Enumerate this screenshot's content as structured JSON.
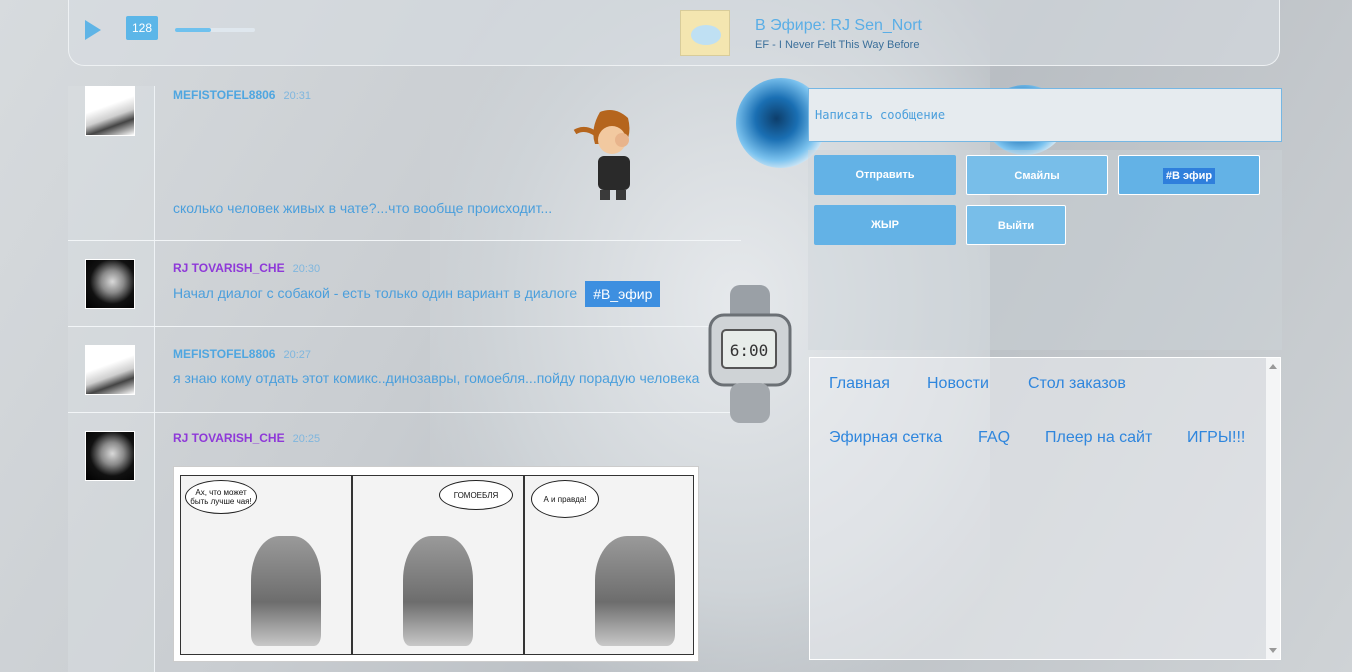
{
  "player": {
    "volume": "128",
    "progress": 0.45,
    "now_playing_title": "В Эфире: RJ Sen_Nort",
    "now_playing_track": "EF - I Never Felt This Way Before"
  },
  "chat": {
    "messages": [
      {
        "nick": "MEFISTOFEL8806",
        "time": "20:31",
        "text": "сколько человек живых в чате?...что вообще происходит...",
        "color": "blue",
        "avatar": "cat-avatar"
      },
      {
        "nick": "RJ TOVARISH_CHE",
        "time": "20:30",
        "text": "Начал диалог с собакой - есть только один вариант в диалоге",
        "tag": "#В_эфир",
        "color": "purple",
        "avatar": "man-avatar"
      },
      {
        "nick": "MEFISTOFEL8806",
        "time": "20:27",
        "text": "я знаю кому отдать этот комикс..динозавры, гомоебля...пойду порадую человека",
        "color": "blue",
        "avatar": "cat-avatar"
      },
      {
        "nick": "RJ TOVARISH_CHE",
        "time": "20:25",
        "color": "purple",
        "avatar": "man-avatar"
      }
    ],
    "comic": {
      "bubble1": "Ах, что может быть лучше чая!",
      "bubble2": "ГОМОЕБЛЯ",
      "bubble3": "А и правда!"
    }
  },
  "compose": {
    "placeholder": "Написать сообщение"
  },
  "buttons": {
    "send": "Отправить",
    "smiles": "Смайлы",
    "on_air": "#В эфир",
    "zhyr": "ЖЫР",
    "logout": "Выйти"
  },
  "nav": {
    "links": [
      "Главная",
      "Новости",
      "Стол заказов",
      "Эфирная сетка",
      "FAQ",
      "Плеер на сайт",
      "ИГРЫ!!!"
    ]
  },
  "colors": {
    "accent": "#5cb6e8",
    "nick_blue": "#4fa6e0",
    "nick_purple": "#8e38d8",
    "link": "#2f86dd"
  }
}
